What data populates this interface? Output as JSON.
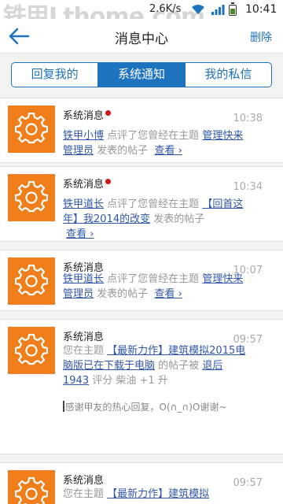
{
  "status_bar": {
    "watermark": "铁甲Lthome.com",
    "speed": "2.6K/s",
    "time": "10:41",
    "battery_level": 0.55
  },
  "header": {
    "back_icon": "back-arrow-icon",
    "title": "消息中心",
    "delete_label": "删除"
  },
  "tabs": [
    {
      "label": "回复我的",
      "active": false
    },
    {
      "label": "系统通知",
      "active": true
    },
    {
      "label": "我的私信",
      "active": false
    }
  ],
  "messages": [
    {
      "icon": "gear-icon",
      "sender": "系统消息",
      "unread": true,
      "time": "10:38",
      "user": "铁甲小博",
      "text1": "点评了您曾经在主题",
      "topic": "管理快来 管理员",
      "text2": "发表的帖子",
      "view": "查看 ›"
    },
    {
      "icon": "gear-icon",
      "sender": "系统消息",
      "unread": true,
      "time": "10:34",
      "user": "铁甲道长",
      "text1": "点评了您曾经在主题",
      "topic": "【回首这年】我2014的改变",
      "text2": "发表的帖子",
      "view": "查看 ›"
    },
    {
      "icon": "gear-icon",
      "sender": "系统消息",
      "unread": false,
      "time": "10:07",
      "user": "铁甲道长",
      "text1": "点评了您曾经在主题",
      "topic": "管理快来 管理员",
      "text2": "发表的帖子",
      "view": "查看 ›"
    },
    {
      "icon": "gear-icon",
      "sender": "系统消息",
      "unread": false,
      "time": "09:57",
      "text1": "您在主题",
      "topic": "【最新力作】建筑模拟2015电脑版已在下载于电脑",
      "text2": "的帖子被",
      "user": "退后1943",
      "text3": "评分 柴油 +1 升",
      "reply": "感谢甲友的热心回复，O(∩_∩)O谢谢~"
    },
    {
      "icon": "gear-icon",
      "sender": "系统消息",
      "unread": false,
      "time": "09:57",
      "text1": "您在主题",
      "topic": "【最新力作】建筑模拟"
    }
  ]
}
